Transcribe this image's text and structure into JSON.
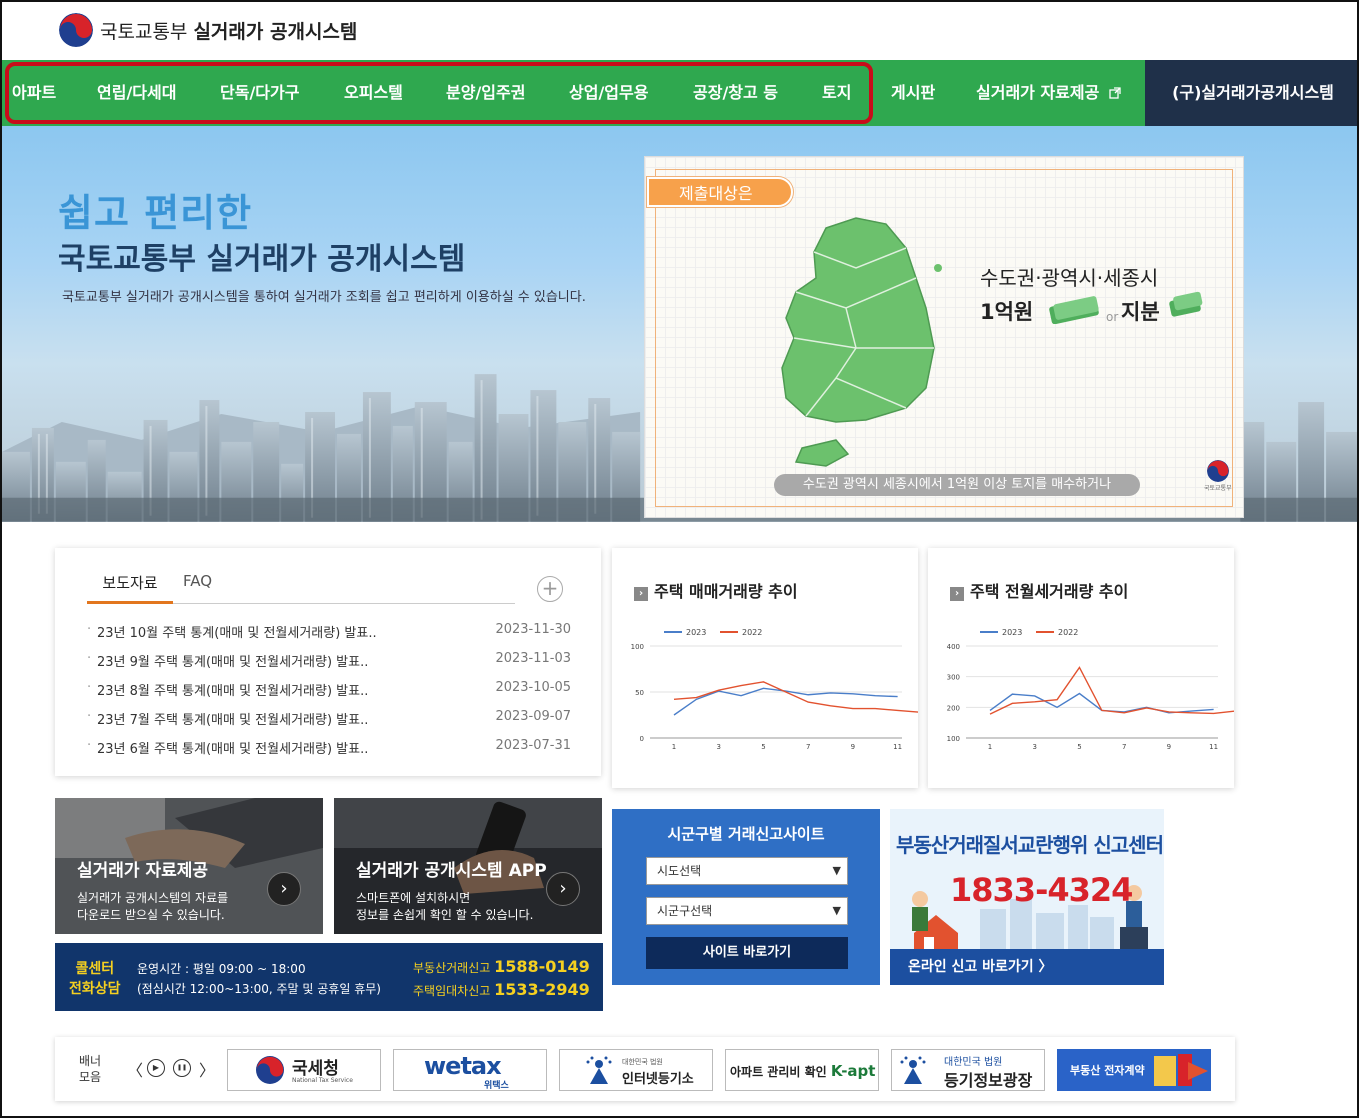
{
  "header": {
    "ministry": "국토교통부",
    "system": "실거래가 공개시스템"
  },
  "nav": {
    "items": [
      "아파트",
      "연립/다세대",
      "단독/다가구",
      "오피스텔",
      "분양/입주권",
      "상업/업무용",
      "공장/창고 등",
      "토지",
      "게시판",
      "실거래가 자료제공"
    ],
    "old_system": "(구)실거래가공개시스템"
  },
  "hero": {
    "title1": "쉽고 편리한",
    "title2": "국토교통부 실거래가 공개시스템",
    "desc": "국토교통부 실거래가 공개시스템을 통하여 실거래가 조회를 쉽고 편리하게 이용하실 수 있습니다."
  },
  "map_panel": {
    "badge": "제출대상은",
    "line1": "수도권·광역시·세종시",
    "line2": "1억원",
    "or": "or",
    "line3": "지분",
    "caption": "수도권 광역시 세종시에서 1억원 이상 토지를 매수하거나",
    "seal_label": "국토교통부"
  },
  "news": {
    "tab_active": "보도자료",
    "tab_inactive": "FAQ",
    "more": "+",
    "items": [
      {
        "title": "23년 10월 주택 통계(매매 및 전월세거래량) 발표..",
        "date": "2023-11-30"
      },
      {
        "title": "23년 9월 주택 통계(매매 및 전월세거래량) 발표..",
        "date": "2023-11-03"
      },
      {
        "title": "23년 8월 주택 통계(매매 및 전월세거래량) 발표..",
        "date": "2023-10-05"
      },
      {
        "title": "23년 7월 주택 통계(매매 및 전월세거래량) 발표..",
        "date": "2023-09-07"
      },
      {
        "title": "23년 6월 주택 통계(매매 및 전월세거래량) 발표..",
        "date": "2023-07-31"
      }
    ]
  },
  "chart_data": [
    {
      "type": "line",
      "title": "주택 매매거래량 추이",
      "x": [
        1,
        2,
        3,
        4,
        5,
        6,
        7,
        8,
        9,
        10,
        11,
        12
      ],
      "xticks": [
        1,
        3,
        5,
        7,
        9,
        11
      ],
      "yticks": [
        0,
        50,
        100
      ],
      "ylim": [
        0,
        100
      ],
      "series": [
        {
          "name": "2023",
          "color": "#4a7ec9",
          "values": [
            25,
            42,
            51,
            46,
            54,
            51,
            47,
            49,
            48,
            46,
            45
          ]
        },
        {
          "name": "2022",
          "color": "#e2522f",
          "values": [
            42,
            44,
            52,
            57,
            61,
            50,
            39,
            35,
            32,
            32,
            30,
            28
          ]
        }
      ]
    },
    {
      "type": "line",
      "title": "주택 전월세거래량 추이",
      "x": [
        1,
        2,
        3,
        4,
        5,
        6,
        7,
        8,
        9,
        10,
        11,
        12
      ],
      "xticks": [
        1,
        3,
        5,
        7,
        9,
        11
      ],
      "yticks": [
        100,
        200,
        300,
        400
      ],
      "ylim": [
        100,
        400
      ],
      "series": [
        {
          "name": "2023",
          "color": "#4a7ec9",
          "values": [
            190,
            243,
            237,
            200,
            245,
            190,
            185,
            200,
            182,
            188,
            193
          ]
        },
        {
          "name": "2022",
          "color": "#e2522f",
          "values": [
            178,
            213,
            218,
            225,
            330,
            190,
            182,
            198,
            185,
            182,
            180,
            188
          ]
        }
      ]
    }
  ],
  "promo": {
    "data_title": "실거래가 자료제공",
    "data_desc": "실거래가 공개시스템의 자료를\n다운로드 받으실 수 있습니다.",
    "app_title": "실거래가 공개시스템 APP",
    "app_desc": "스마트폰에 설치하시면\n정보를 손쉽게 확인 할 수 있습니다.",
    "arrow": "›"
  },
  "callcenter": {
    "label1": "콜센터",
    "label2": "전화상담",
    "hours1": "운영시간 : 평일 09:00 ~ 18:00",
    "hours2": "(점심시간 12:00~13:00, 주말 및 공휴일 휴무)",
    "line1_label": "부동산거래신고",
    "line1_num": "1588-0149",
    "line2_label": "주택임대차신고",
    "line2_num": "1533-2949"
  },
  "sigun": {
    "title": "시군구별 거래신고사이트",
    "sido": "시도선택",
    "sigungu": "시군구선택",
    "go": "사이트 바로가기"
  },
  "report": {
    "title": "부동산거래질서교란행위 신고센터",
    "phone": "1833-4324",
    "link": "온라인 신고 바로가기 〉"
  },
  "banners": {
    "label1": "배너",
    "label2": "모음",
    "prev": "〈",
    "next": "〉",
    "play": "▶",
    "pause": "❚❚",
    "nts": "국세청",
    "nts_en": "National Tax Service",
    "wetax": "wetax",
    "wetax_kr": "위택스",
    "iros_small": "대한민국 법원",
    "iros": "인터넷등기소",
    "kapt_text": "아파트 관리비 확인",
    "kapt": "K-apt",
    "court_small": "대한민국 법원",
    "court": "등기정보광장",
    "econtract": "부동산 전자계약"
  }
}
